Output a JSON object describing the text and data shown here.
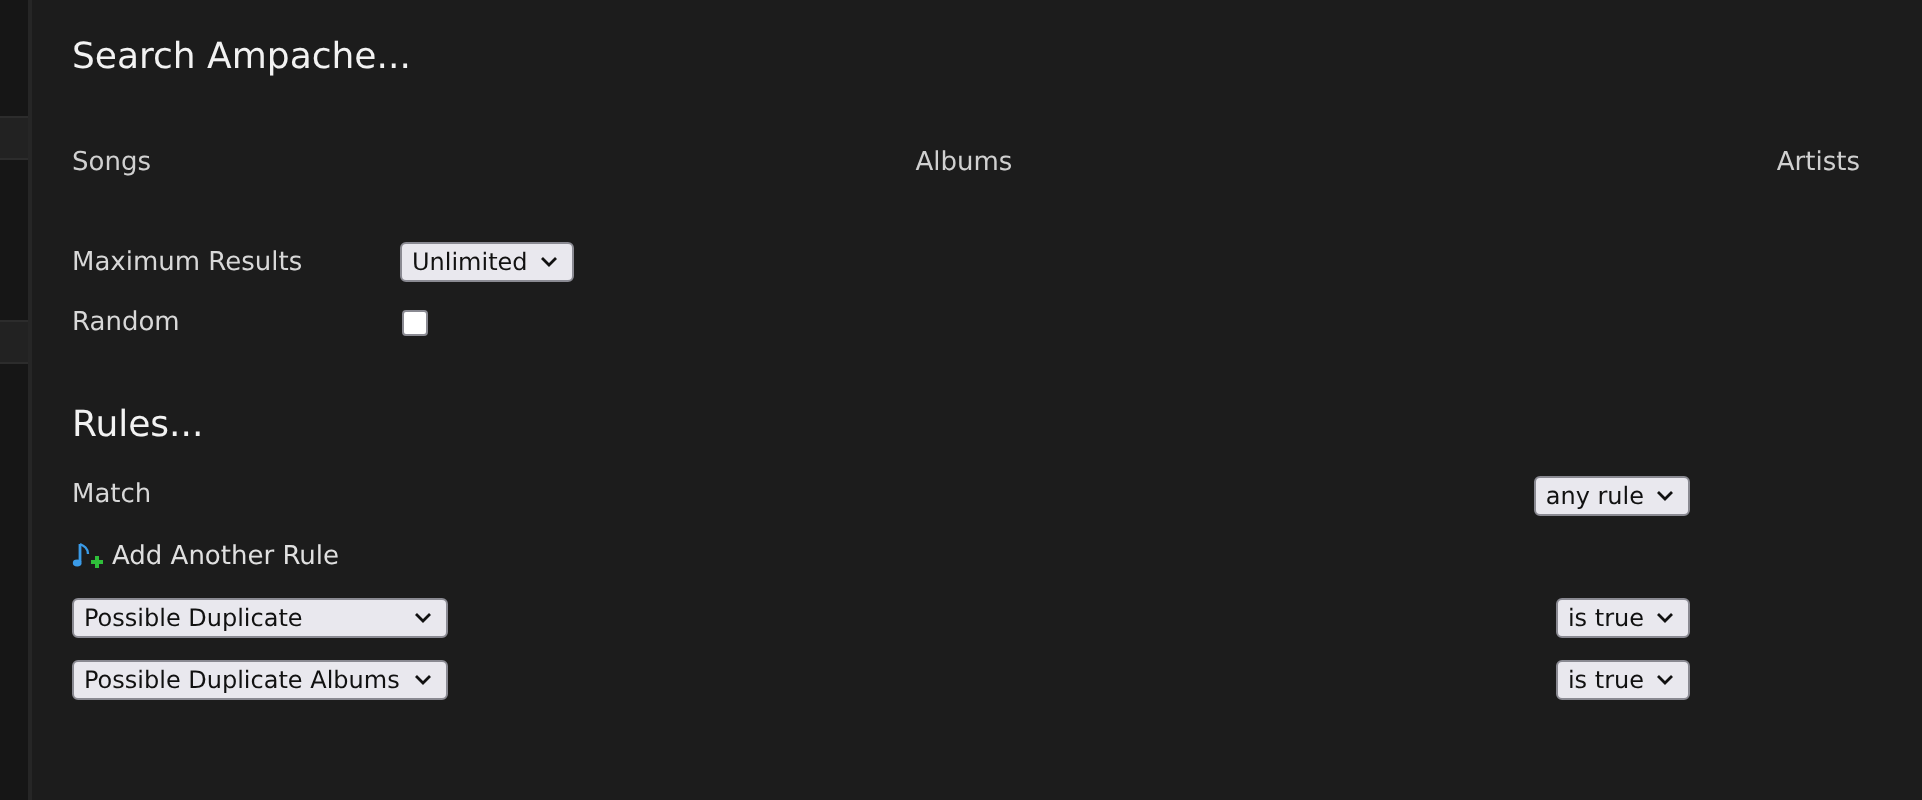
{
  "title": "Search Ampache...",
  "types": [
    {
      "label": "Songs"
    },
    {
      "label": "Albums"
    },
    {
      "label": "Artists"
    }
  ],
  "options": [
    {
      "kind": "select",
      "label": "Maximum Results",
      "value": "Unlimited"
    },
    {
      "kind": "checkbox",
      "label": "Random",
      "checked": false
    }
  ],
  "rules": {
    "heading": "Rules...",
    "match_label": "Match",
    "match_value": "any rule",
    "add_label": "Add Another Rule",
    "items": [
      {
        "field": "Possible Duplicate",
        "operator": "is true"
      },
      {
        "field": "Possible Duplicate Albums",
        "operator": "is true"
      }
    ]
  }
}
